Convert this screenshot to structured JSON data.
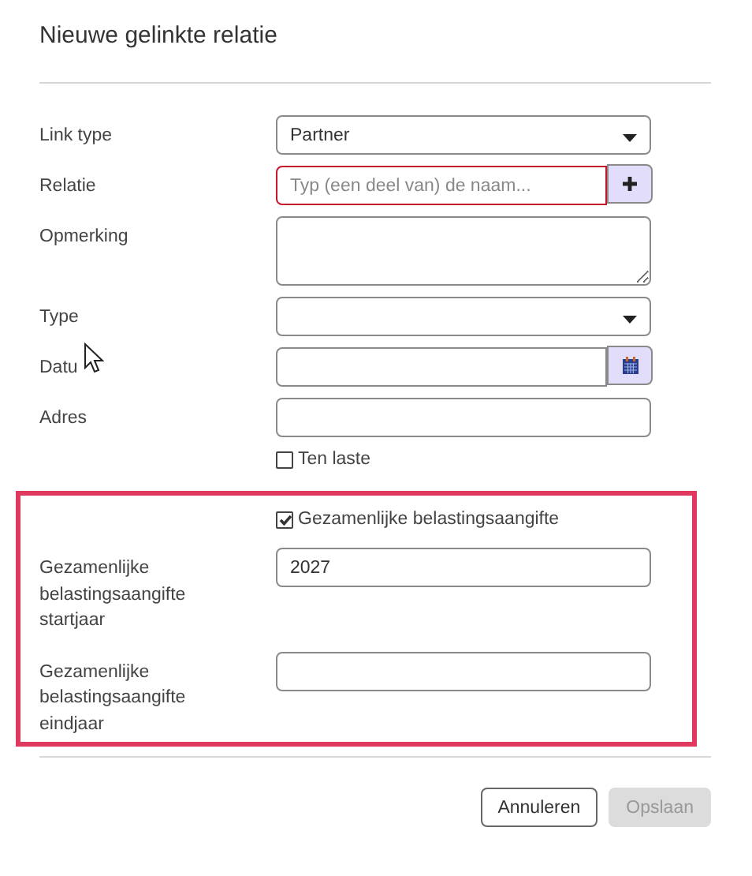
{
  "dialog": {
    "title": "Nieuwe gelinkte relatie"
  },
  "fields": [
    {
      "kind": "select",
      "label": "Link type",
      "value": "Partner"
    },
    {
      "kind": "lookup",
      "label": "Relatie",
      "placeholder": "Typ (een deel van) de naam...",
      "invalid": true
    },
    {
      "kind": "textarea",
      "label": "Opmerking"
    },
    {
      "kind": "select",
      "label": "Type"
    },
    {
      "kind": "date",
      "label": "Datu"
    },
    {
      "kind": "input",
      "label": "Adres"
    },
    {
      "kind": "checkbox",
      "label": "Ten laste",
      "checked": false
    }
  ],
  "highlighted_section": {
    "fields": [
      {
        "kind": "checkbox",
        "label": "Gezamenlijke belastingsaangifte",
        "checked": true
      },
      {
        "kind": "input",
        "label": "Gezamenlijke belastingsaangifte startjaar",
        "value": "2027"
      },
      {
        "kind": "input",
        "label": "Gezamenlijke belastingsaangifte eindjaar"
      }
    ]
  },
  "buttons": [
    {
      "label": "Annuleren",
      "disabled": false
    },
    {
      "label": "Opslaan",
      "disabled": true
    }
  ]
}
